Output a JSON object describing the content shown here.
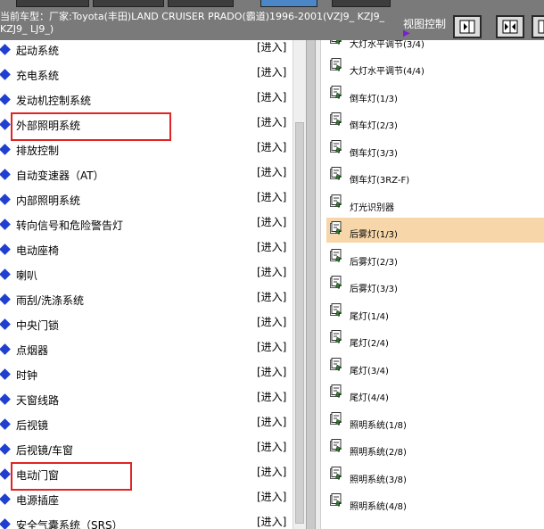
{
  "header": {
    "vehicle_text": "当前车型：厂家:Toyota(丰田)LAND CRUISER PRADO(霸道)1996-2001(VZJ9_ KZJ9_ KZJ9_ LJ9_)",
    "view_label": "视图控制",
    "view_buttons": [
      "panel-right-icon",
      "split-panels-icon",
      "panel-left-icon"
    ]
  },
  "left_list": {
    "action_label": "[进入]",
    "items": [
      "起动系统",
      "充电系统",
      "发动机控制系统",
      "外部照明系统",
      "排放控制",
      "自动变速器（AT）",
      "内部照明系统",
      "转向信号和危险警告灯",
      "电动座椅",
      "喇叭",
      "雨刮/洗涤系统",
      "中央门锁",
      "点烟器",
      "时钟",
      "天窗线路",
      "后视镜",
      "后视镜/车窗",
      "电动门窗",
      "电源插座",
      "安全气囊系统（SRS）"
    ],
    "highlighted": [
      "外部照明系统",
      "电动门窗"
    ]
  },
  "right_list": {
    "top_partial": "大灯水平调节(3/4)",
    "selected": "后雾灯(1/3)",
    "items": [
      "大灯水平调节(4/4)",
      "倒车灯(1/3)",
      "倒车灯(2/3)",
      "倒车灯(3/3)",
      "倒车灯(3RZ-F)",
      "灯光识别器",
      "后雾灯(1/3)",
      "后雾灯(2/3)",
      "后雾灯(3/3)",
      "尾灯(1/4)",
      "尾灯(2/4)",
      "尾灯(3/4)",
      "尾灯(4/4)",
      "照明系统(1/8)",
      "照明系统(2/8)",
      "照明系统(3/8)",
      "照明系统(4/8)"
    ]
  },
  "colors": {
    "header_bg": "#7a7a7a",
    "selection_bg": "#f7d7aa",
    "highlight_border": "#e02424",
    "bullet": "#1f3fd0"
  }
}
